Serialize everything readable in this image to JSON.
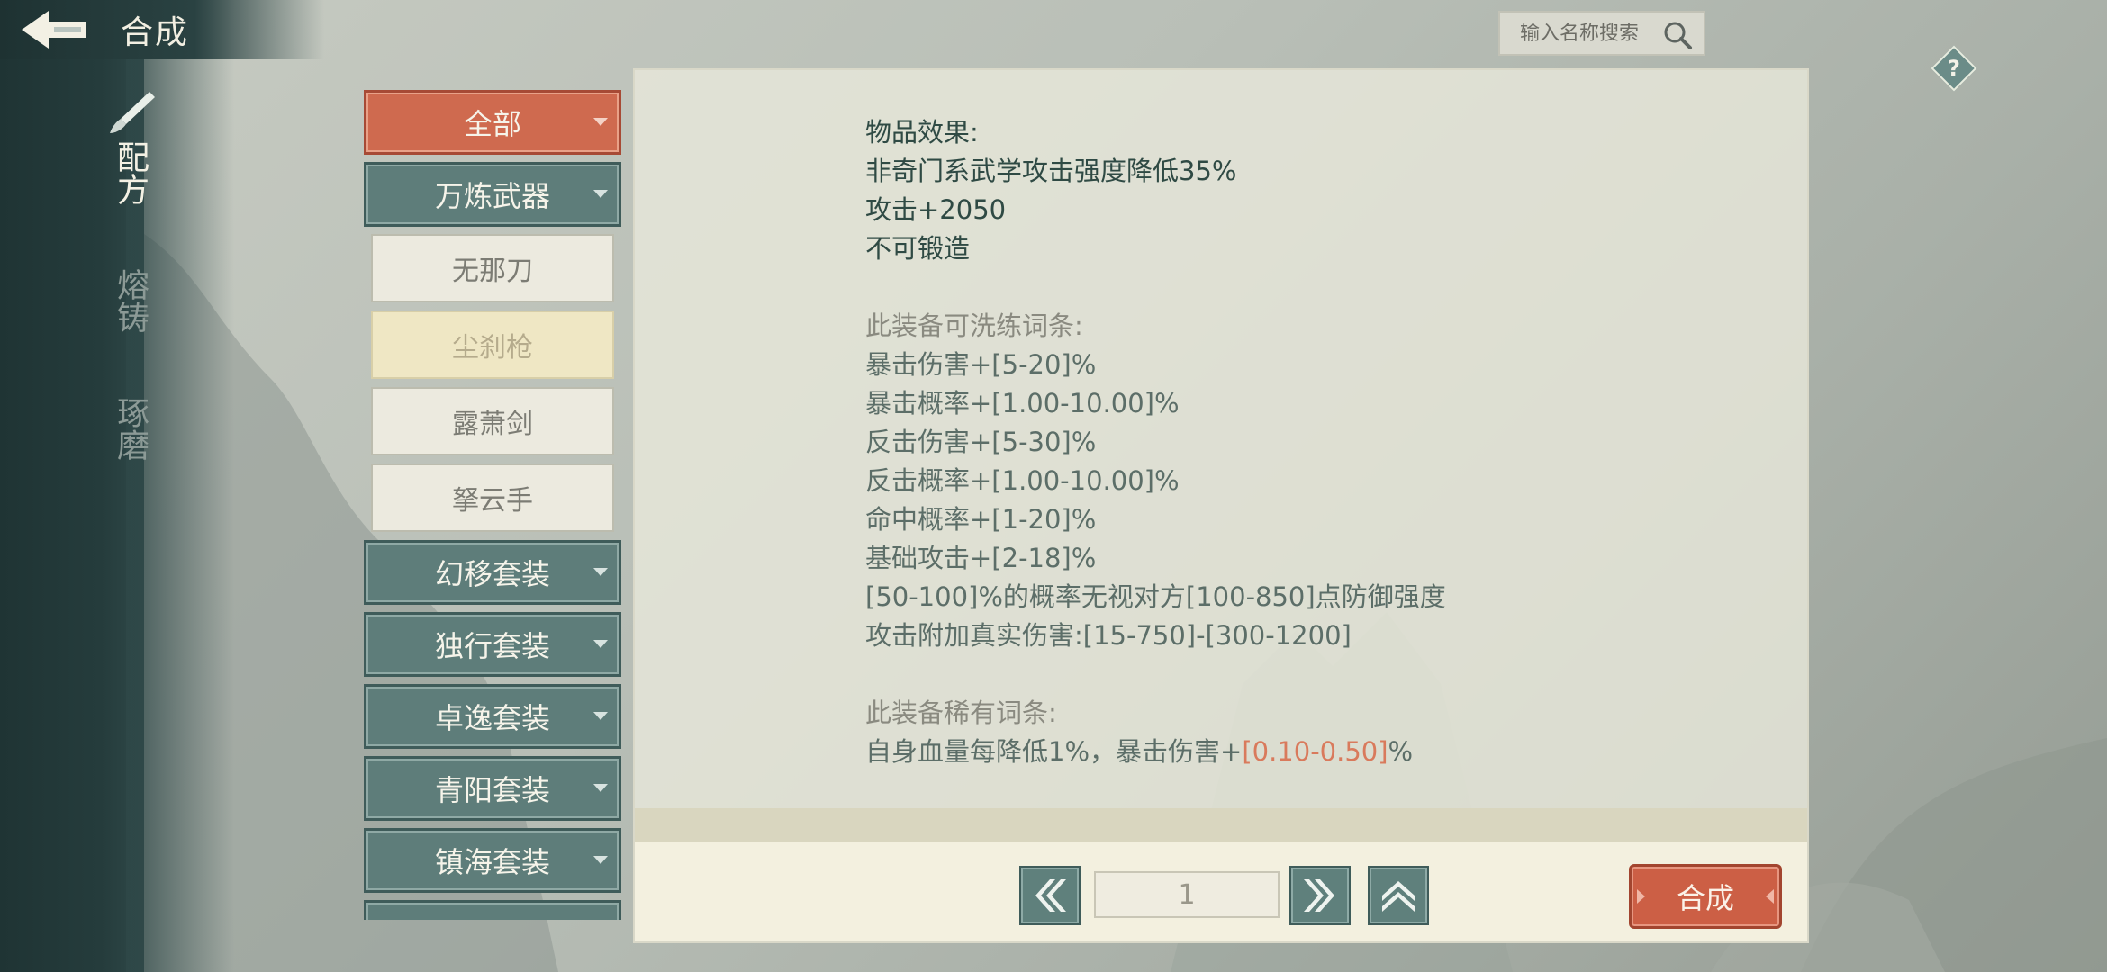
{
  "header": {
    "title": "合成"
  },
  "search": {
    "placeholder": "输入名称搜索"
  },
  "side_tabs": [
    {
      "label": "配方",
      "active": true
    },
    {
      "label": "熔铸",
      "active": false
    },
    {
      "label": "琢磨",
      "active": false
    }
  ],
  "categories": {
    "all_label": "全部",
    "group_label": "万炼武器",
    "items": [
      "无那刀",
      "尘刹枪",
      "露萧剑",
      "拏云手"
    ],
    "selected_item": "尘刹枪",
    "sets": [
      "幻移套装",
      "独行套装",
      "卓逸套装",
      "青阳套装",
      "镇海套装"
    ]
  },
  "detail": {
    "effect_title": "物品效果:",
    "effects": [
      "非奇门系武学攻击强度降低35%",
      "攻击+2050",
      "不可锻造"
    ],
    "refine_title": "此装备可洗练词条:",
    "refine_lines": [
      "暴击伤害+[5-20]%",
      "暴击概率+[1.00-10.00]%",
      "反击伤害+[5-30]%",
      "反击概率+[1.00-10.00]%",
      "命中概率+[1-20]%",
      "基础攻击+[2-18]%",
      "[50-100]%的概率无视对方[100-850]点防御强度",
      "攻击附加真实伤害:[15-750]-[300-1200]"
    ],
    "rare_title": "此装备稀有词条:",
    "rare_prefix": "自身血量每降低1%，暴击伤害+",
    "rare_value": "[0.10-0.50]",
    "rare_suffix": "%"
  },
  "pager": {
    "page": "1"
  },
  "actions": {
    "craft_label": "合成"
  },
  "colors": {
    "accent_red": "#cc5f45",
    "teal": "#5f807c",
    "rare_value": "#d97a5c"
  },
  "icons": [
    "back-arrow-icon",
    "brush-icon",
    "search-icon",
    "help-icon",
    "prev-page-icon",
    "next-page-icon",
    "collapse-icon"
  ]
}
